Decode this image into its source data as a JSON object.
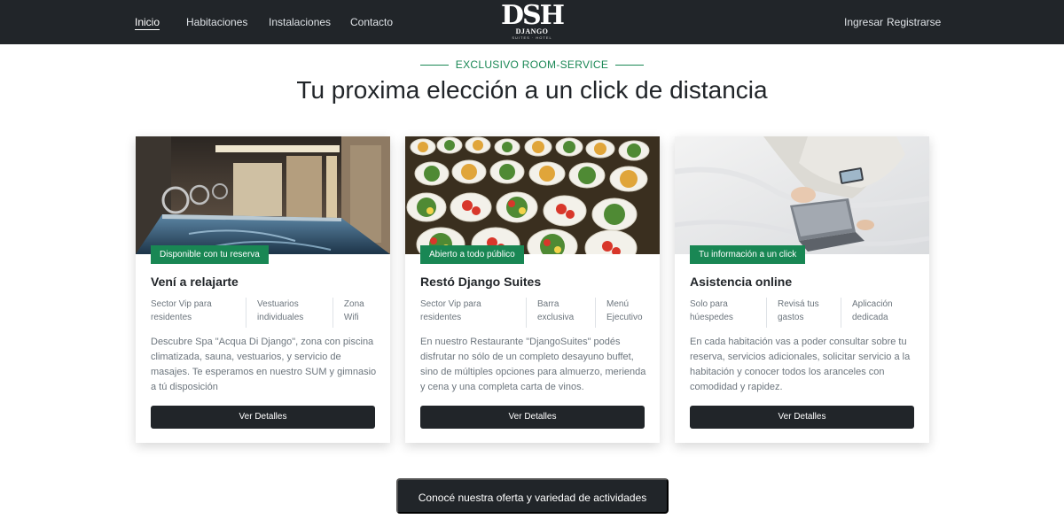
{
  "nav": {
    "links": [
      "Inicio",
      "Habitaciones",
      "Instalaciones",
      "Contacto"
    ],
    "login": "Ingresar",
    "register": "Registrarse"
  },
  "brand": {
    "mark": "DSH",
    "name": "DJANGO",
    "tagline": "SUITES · HOTEL"
  },
  "section": {
    "eyebrow": "EXCLUSIVO ROOM-SERVICE",
    "title": "Tu proxima elección a un click de distancia"
  },
  "cards": [
    {
      "badge": "Disponible con tu reserva",
      "title": "Vení a relajarte",
      "features": [
        "Sector Vip para residentes",
        "Vestuarios individuales",
        "Zona Wifi"
      ],
      "text": "Descubre Spa \"Acqua Di Django\", zona con piscina climatizada, sauna, vestuarios, y servicio de masajes. Te esperamos en nuestro SUM y gimnasio a tú disposición",
      "button": "Ver Detalles",
      "image": "spa-pool-image"
    },
    {
      "badge": "Abierto a todo público",
      "title": "Restó Django Suites",
      "features": [
        "Sector Vip para residentes",
        "Barra exclusiva",
        "Menú Ejecutivo"
      ],
      "text": "En nuestro Restaurante \"DjangoSuites\" podés disfrutar no sólo de un completo desayuno buffet, sino de múltiples opciones para almuerzo, merienda y cena y una completa carta de vinos.",
      "button": "Ver Detalles",
      "image": "buffet-food-image"
    },
    {
      "badge": "Tu información a un click",
      "title": "Asistencia online",
      "features": [
        "Solo para húespedes",
        "Revisá tus gastos",
        "Aplicación dedicada"
      ],
      "text": "En cada habitación vas a poder consultar sobre tu reserva, servicios adicionales, solicitar servicio a la habitación y conocer todos los aranceles con comodidad y rapidez.",
      "button": "Ver Detalles",
      "image": "laptop-bed-image"
    }
  ],
  "cta": "Conocé nuestra oferta y variedad de actividades",
  "colors": {
    "dark": "#212529",
    "accent": "#198754",
    "muted": "#6c757d"
  }
}
